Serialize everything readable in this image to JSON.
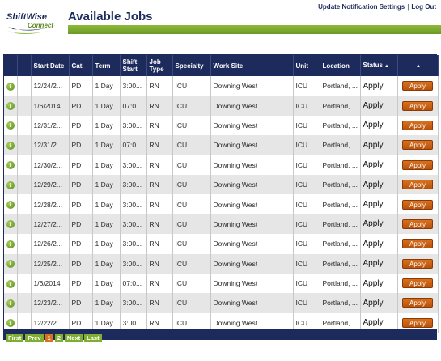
{
  "header": {
    "logo_top": "ShiftWise",
    "logo_bottom": "Connect",
    "title": "Available Jobs",
    "links": [
      "Update Notification Settings",
      "Log Out"
    ],
    "separator": "|"
  },
  "table": {
    "columns": [
      "",
      "",
      "Start Date",
      "Cat.",
      "Term",
      "Shift Start",
      "Job Type",
      "Specialty",
      "Work Site",
      "Unit",
      "Location",
      "Status",
      ""
    ],
    "sorted_column_arrow": "▲",
    "apply_label": "Apply",
    "info_glyph": "i",
    "rows": [
      {
        "date": "12/24/2...",
        "cat": "PD",
        "term": "1 Day",
        "shift": "3:00...",
        "type": "RN",
        "specialty": "ICU",
        "site": "Downing West",
        "unit": "ICU",
        "location": "Portland, ...",
        "status": "Apply"
      },
      {
        "date": "1/6/2014",
        "cat": "PD",
        "term": "1 Day",
        "shift": "07:0...",
        "type": "RN",
        "specialty": "ICU",
        "site": "Downing West",
        "unit": "ICU",
        "location": "Portland, ...",
        "status": "Apply"
      },
      {
        "date": "12/31/2...",
        "cat": "PD",
        "term": "1 Day",
        "shift": "3:00...",
        "type": "RN",
        "specialty": "ICU",
        "site": "Downing West",
        "unit": "ICU",
        "location": "Portland, ...",
        "status": "Apply"
      },
      {
        "date": "12/31/2...",
        "cat": "PD",
        "term": "1 Day",
        "shift": "07:0...",
        "type": "RN",
        "specialty": "ICU",
        "site": "Downing West",
        "unit": "ICU",
        "location": "Portland, ...",
        "status": "Apply"
      },
      {
        "date": "12/30/2...",
        "cat": "PD",
        "term": "1 Day",
        "shift": "3:00...",
        "type": "RN",
        "specialty": "ICU",
        "site": "Downing West",
        "unit": "ICU",
        "location": "Portland, ...",
        "status": "Apply"
      },
      {
        "date": "12/29/2...",
        "cat": "PD",
        "term": "1 Day",
        "shift": "3:00...",
        "type": "RN",
        "specialty": "ICU",
        "site": "Downing West",
        "unit": "ICU",
        "location": "Portland, ...",
        "status": "Apply"
      },
      {
        "date": "12/28/2...",
        "cat": "PD",
        "term": "1 Day",
        "shift": "3:00...",
        "type": "RN",
        "specialty": "ICU",
        "site": "Downing West",
        "unit": "ICU",
        "location": "Portland, ...",
        "status": "Apply"
      },
      {
        "date": "12/27/2...",
        "cat": "PD",
        "term": "1 Day",
        "shift": "3:00...",
        "type": "RN",
        "specialty": "ICU",
        "site": "Downing West",
        "unit": "ICU",
        "location": "Portland, ...",
        "status": "Apply"
      },
      {
        "date": "12/26/2...",
        "cat": "PD",
        "term": "1 Day",
        "shift": "3:00...",
        "type": "RN",
        "specialty": "ICU",
        "site": "Downing West",
        "unit": "ICU",
        "location": "Portland, ...",
        "status": "Apply"
      },
      {
        "date": "12/25/2...",
        "cat": "PD",
        "term": "1 Day",
        "shift": "3:00...",
        "type": "RN",
        "specialty": "ICU",
        "site": "Downing West",
        "unit": "ICU",
        "location": "Portland, ...",
        "status": "Apply"
      },
      {
        "date": "1/6/2014",
        "cat": "PD",
        "term": "1 Day",
        "shift": "07:0...",
        "type": "RN",
        "specialty": "ICU",
        "site": "Downing West",
        "unit": "ICU",
        "location": "Portland, ...",
        "status": "Apply"
      },
      {
        "date": "12/23/2...",
        "cat": "PD",
        "term": "1 Day",
        "shift": "3:00...",
        "type": "RN",
        "specialty": "ICU",
        "site": "Downing West",
        "unit": "ICU",
        "location": "Portland, ...",
        "status": "Apply"
      },
      {
        "date": "12/22/2...",
        "cat": "PD",
        "term": "1 Day",
        "shift": "3:00...",
        "type": "RN",
        "specialty": "ICU",
        "site": "Downing West",
        "unit": "ICU",
        "location": "Portland, ...",
        "status": "Apply"
      }
    ]
  },
  "pager": {
    "items": [
      "First",
      "Prev",
      "1",
      "2",
      "Next",
      "Last"
    ],
    "current": "1"
  },
  "colors": {
    "navy": "#1d2a5c",
    "green": "#7fae30",
    "orange": "#d8701c"
  }
}
